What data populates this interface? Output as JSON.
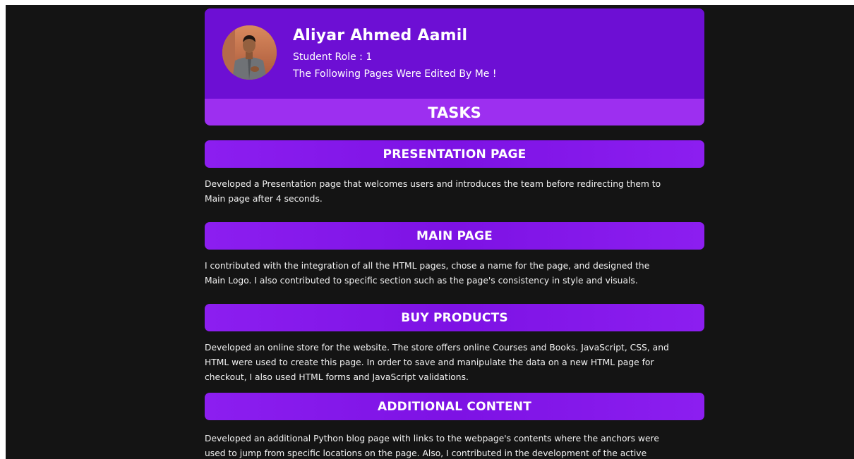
{
  "profile": {
    "name": "Aliyar Ahmed Aamil",
    "role": "Student Role : 1",
    "note": "The Following Pages Were Edited By Me !"
  },
  "tasks_heading": "TASKS",
  "sections": [
    {
      "title": "PRESENTATION PAGE",
      "text": "Developed a Presentation page that welcomes users and introduces the team before redirecting them to\nMain page after 4 seconds."
    },
    {
      "title": "MAIN PAGE",
      "text": "I contributed with the integration of all the HTML pages, chose a name for the page, and designed the\nMain Logo. I also contributed to specific section such as the page's consistency in style and visuals."
    },
    {
      "title": "BUY PRODUCTS",
      "text": "Developed an online store for the website. The store offers online Courses and Books. JavaScript, CSS, and\nHTML were used to create this page. In order to save and manipulate the data on a new HTML page for\ncheckout, I also used HTML forms and JavaScript validations."
    },
    {
      "title": "ADDITIONAL CONTENT",
      "text": "Developed an additional Python blog page with links to the webpage's contents where the anchors were\nused to jump from specific locations on the page. Also, I contributed in the development of the active"
    }
  ]
}
